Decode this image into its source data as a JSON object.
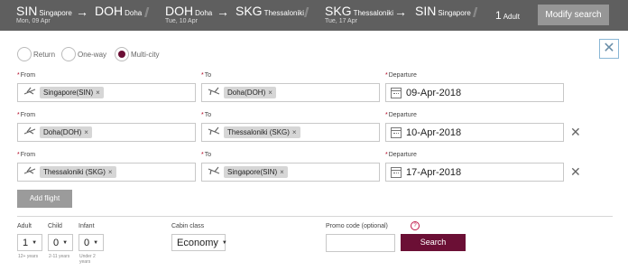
{
  "header": {
    "segments": [
      {
        "code": "SIN",
        "city": "Singapore",
        "date": "Mon, 09 Apr"
      },
      {
        "code": "DOH",
        "city": "Doha",
        "date": ""
      },
      {
        "code": "DOH",
        "city": "Doha",
        "date": "Tue, 10 Apr"
      },
      {
        "code": "SKG",
        "city": "Thessaloniki",
        "date": ""
      },
      {
        "code": "SKG",
        "city": "Thessaloniki",
        "date": "Tue, 17 Apr"
      },
      {
        "code": "SIN",
        "city": "Singapore",
        "date": ""
      }
    ],
    "arrow": "→",
    "separator": "//",
    "adult_count": "1",
    "adult_label": "Adult",
    "modify_label": "Modify search"
  },
  "close_glyph": "✕",
  "trip_types": [
    {
      "label": "Return",
      "selected": false
    },
    {
      "label": "One-way",
      "selected": false
    },
    {
      "label": "Multi-city",
      "selected": true
    }
  ],
  "labels": {
    "from": "From",
    "to": "To",
    "departure": "Departure",
    "req": "*"
  },
  "flights": [
    {
      "from": "Singapore(SIN)",
      "to": "Doha(DOH)",
      "date": "09-Apr-2018",
      "removable": false
    },
    {
      "from": "Doha(DOH)",
      "to": "Thessaloniki (SKG)",
      "date": "10-Apr-2018",
      "removable": true
    },
    {
      "from": "Thessaloniki (SKG)",
      "to": "Singapore(SIN)",
      "date": "17-Apr-2018",
      "removable": true
    }
  ],
  "chip_x": "×",
  "remove_glyph": "✕",
  "add_flight_label": "Add flight",
  "passengers": {
    "adult": {
      "label": "Adult",
      "value": "1",
      "sub": "12+ years"
    },
    "child": {
      "label": "Child",
      "value": "0",
      "sub": "2-11 years"
    },
    "infant": {
      "label": "Infant",
      "value": "0",
      "sub": "Under 2 years"
    }
  },
  "cabin": {
    "label": "Cabin class",
    "value": "Economy"
  },
  "promo": {
    "label": "Promo code (optional)",
    "value": "",
    "help": "?"
  },
  "search_label": "Search",
  "caret": "▼",
  "colors": {
    "header_bg": "#5f5f5f",
    "accent": "#6b0f35",
    "button_grey": "#969696"
  }
}
